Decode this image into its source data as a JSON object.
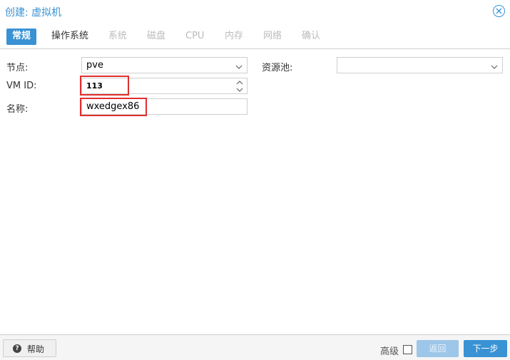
{
  "window": {
    "title": "创建: 虚拟机"
  },
  "tabs": [
    {
      "label": "常规",
      "state": "active"
    },
    {
      "label": "操作系统",
      "state": "enabled"
    },
    {
      "label": "系统",
      "state": "disabled"
    },
    {
      "label": "磁盘",
      "state": "disabled"
    },
    {
      "label": "CPU",
      "state": "disabled"
    },
    {
      "label": "内存",
      "state": "disabled"
    },
    {
      "label": "网络",
      "state": "disabled"
    },
    {
      "label": "确认",
      "state": "disabled"
    }
  ],
  "form": {
    "node": {
      "label": "节点:",
      "value": "pve"
    },
    "vmid": {
      "label": "VM ID:",
      "value": "113"
    },
    "name": {
      "label": "名称:",
      "value": "wxedgex86"
    },
    "pool": {
      "label": "资源池:",
      "value": ""
    }
  },
  "footer": {
    "help_label": "帮助",
    "advanced_label": "高级",
    "back_label": "返回",
    "next_label": "下一步"
  },
  "colors": {
    "accent": "#3892d4",
    "highlight": "#e0302e"
  }
}
